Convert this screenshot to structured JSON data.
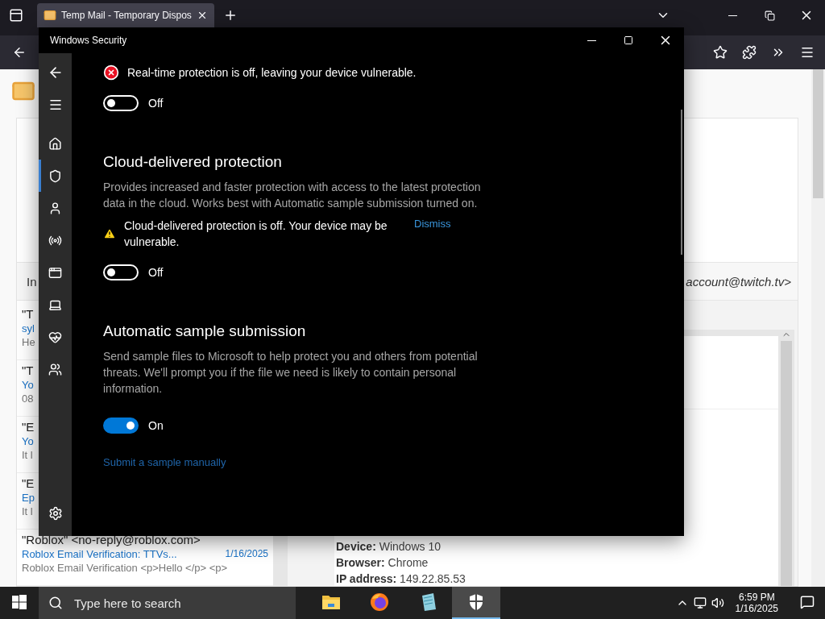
{
  "browser": {
    "tabs": [
      {
        "title": "Temp Mail - Temporary Dispos",
        "selected": true
      }
    ],
    "page": {
      "list_tab": "In",
      "list_items": [
        {
          "sender": "\"T",
          "subject": "syl",
          "preview": "He"
        },
        {
          "sender": "\"T",
          "subject": "Yo",
          "preview": "08"
        },
        {
          "sender": "\"E",
          "subject": "Yo",
          "preview": "It l"
        },
        {
          "sender": "\"E",
          "subject": "Ep",
          "preview": "It l"
        },
        {
          "sender": "\"Roblox\" <no-reply@roblox.com>",
          "subject": "Roblox Email Verification: TTVs...",
          "date": "1/16/2025",
          "preview": "Roblox Email Verification <p>Hello </p> <p>"
        }
      ],
      "from": "account@twitch.tv>",
      "details": [
        "**Device:** Windows 10",
        "**Browser:** Chrome",
        "**IP address:** 149.22.85.53"
      ]
    }
  },
  "security": {
    "title": "Windows Security",
    "nav": [
      {
        "kind": "home",
        "selected": false
      },
      {
        "kind": "protection",
        "selected": true
      },
      {
        "kind": "account",
        "selected": false
      },
      {
        "kind": "network",
        "selected": false
      },
      {
        "kind": "app",
        "selected": false
      },
      {
        "kind": "device",
        "selected": false
      },
      {
        "kind": "health",
        "selected": false
      },
      {
        "kind": "family",
        "selected": false
      }
    ],
    "sections": [
      {
        "alert": {
          "kind": "error",
          "text": "Real-time protection is off, leaving your device vulnerable."
        },
        "toggle": {
          "on": false,
          "label": "Off"
        }
      },
      {
        "heading": "Cloud-delivered protection",
        "description": "Provides increased and faster protection with access to the latest protection data in the cloud. Works best with Automatic sample submission turned on.",
        "alert": {
          "kind": "warning",
          "text": "Cloud-delivered protection is off. Your device may be vulnerable.",
          "action": "Dismiss"
        },
        "toggle": {
          "on": false,
          "label": "Off"
        }
      },
      {
        "heading": "Automatic sample submission",
        "description": "Send sample files to Microsoft to help protect you and others from potential threats. We'll prompt you if the file we need is likely to contain personal information.",
        "toggle": {
          "on": true,
          "label": "On"
        },
        "link": "Submit a sample manually"
      }
    ]
  },
  "taskbar": {
    "search": {
      "placeholder": "Type here to search"
    },
    "apps": [
      {
        "kind": "explorer",
        "selected": false
      },
      {
        "kind": "firefox",
        "selected": false
      },
      {
        "kind": "notepad",
        "selected": false
      },
      {
        "kind": "security",
        "selected": true
      }
    ],
    "time": "6:59 PM",
    "date": "1/16/2025"
  }
}
